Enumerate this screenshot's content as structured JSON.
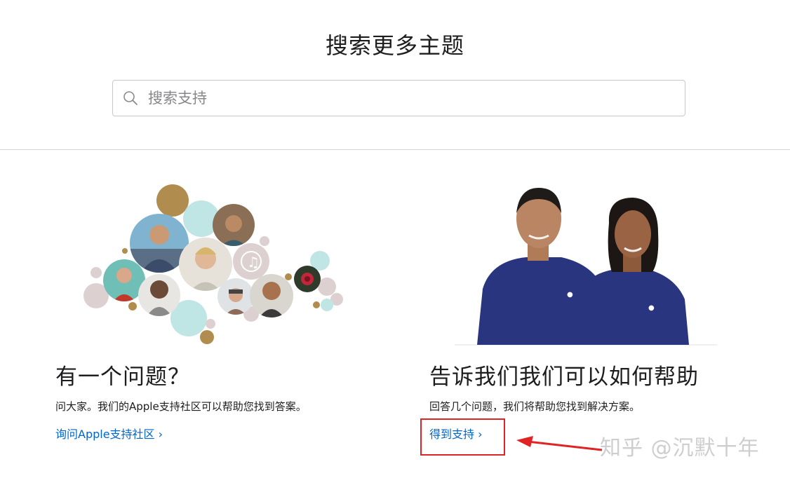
{
  "header": {
    "title": "搜索更多主题"
  },
  "search": {
    "placeholder": "搜索支持",
    "icon": "search-icon"
  },
  "community": {
    "title": "有一个问题？",
    "description": "问大家。我们的Apple支持社区可以帮助您找到答案。",
    "link_label": "询问Apple支持社区 ›"
  },
  "support": {
    "title": "告诉我们我们可以如何帮助",
    "description": "回答几个问题，我们将帮助您找到解决方案。",
    "link_label": "得到支持 ›"
  },
  "annotation": {
    "highlight_color": "#e02424"
  },
  "watermark": {
    "text": "知乎 @沉默十年"
  },
  "colors": {
    "link": "#0066cc",
    "text": "#1d1d1f",
    "bubble_gold": "#b08d4f",
    "bubble_teal": "#bfe6e4",
    "bubble_pink": "#dcd0d1",
    "shirt_navy": "#2a3580"
  }
}
